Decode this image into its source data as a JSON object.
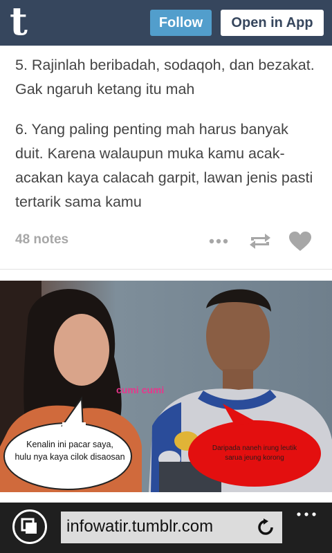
{
  "header": {
    "logo_letter": "t",
    "follow_label": "Follow",
    "open_app_label": "Open in App"
  },
  "post": {
    "paragraphs": [
      "5. Rajinlah beribadah, sodaqoh, dan bezakat. Gak ngaruh ketang itu mah",
      "6. Yang paling penting mah harus banyak duit. Karena walaupun muka kamu acak-acakan kaya calacah garpit, lawan jenis pasti tertarik sama kamu"
    ],
    "notes": "48 notes"
  },
  "photo": {
    "bubble_left": [
      "Kenalin ini pacar saya,",
      "hulu nya kaya cilok disaosan"
    ],
    "bubble_right": [
      "Daripada naneh irung leutik",
      "sarua jeung korong"
    ],
    "watermark": "cumi cumi"
  },
  "browser": {
    "url": "infowatir.tumblr.com"
  },
  "icons": {
    "more": "more-dots-icon",
    "reblog": "reblog-icon",
    "like": "heart-icon",
    "tabs": "tabs-icon",
    "refresh": "refresh-icon",
    "browser_menu": "ellipsis-icon"
  },
  "colors": {
    "header_bg": "#36465d",
    "follow_bg": "#529ecc",
    "icon_gray": "#a7a7a7"
  }
}
